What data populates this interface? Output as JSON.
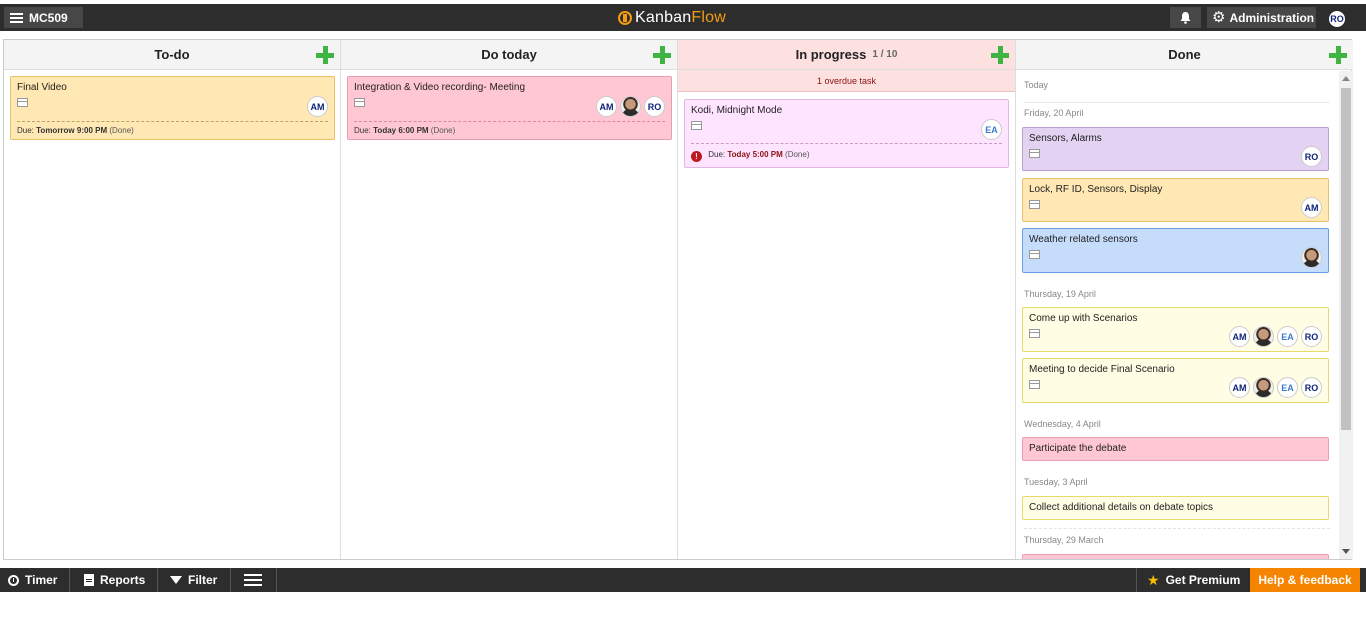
{
  "topbar": {
    "board_name": "MC509",
    "logo_part1": "Kanban",
    "logo_part2": "Flow",
    "admin_label": "Administration",
    "user_initials": "RO"
  },
  "columns": {
    "todo": {
      "title": "To-do"
    },
    "today": {
      "title": "Do today"
    },
    "inprogress": {
      "title": "In progress",
      "wip": "1 / 10",
      "overdue_note": "1 overdue task"
    },
    "done": {
      "title": "Done"
    }
  },
  "tasks": {
    "final_video": {
      "name": "Final Video",
      "avatar": "AM",
      "due_prefix": "Due:",
      "due": "Tomorrow 9:00 PM",
      "status": "(Done)"
    },
    "integration": {
      "name": "Integration & Video recording- Meeting",
      "avatar1": "AM",
      "avatar3": "RO",
      "due_prefix": "Due:",
      "due": "Today 6:00 PM",
      "status": "(Done)"
    },
    "kodi": {
      "name": "Kodi, Midnight Mode",
      "avatar": "EA",
      "due_prefix": "Due:",
      "due": "Today 5:00 PM",
      "status": "(Done)"
    }
  },
  "done": {
    "sep_today": "Today",
    "sep_fri": "Friday, 20 April",
    "sensors_alarms": {
      "name": "Sensors, Alarms",
      "avatar": "RO"
    },
    "lock_rfid": {
      "name": "Lock, RF ID, Sensors, Display",
      "avatar": "AM"
    },
    "weather": {
      "name": "Weather related sensors"
    },
    "sep_thu": "Thursday, 19 April",
    "scenarios": {
      "name": "Come up with Scenarios",
      "a1": "AM",
      "a3": "EA",
      "a4": "RO"
    },
    "meeting_final": {
      "name": "Meeting to decide Final Scenario",
      "a1": "AM",
      "a3": "EA",
      "a4": "RO"
    },
    "sep_wed": "Wednesday, 4 April",
    "debate": {
      "name": "Participate the debate"
    },
    "sep_tue": "Tuesday, 3 April",
    "details": {
      "name": "Collect additional details on debate topics"
    },
    "sep_thu2": "Thursday, 29 March"
  },
  "bottombar": {
    "timer": "Timer",
    "reports": "Reports",
    "filter": "Filter",
    "premium": "Get Premium",
    "help": "Help & feedback"
  },
  "colors": {
    "accent_orange": "#f58400",
    "add_green": "#3fb443",
    "topbar": "#2d2d2d"
  },
  "icons": [
    "menu-icon",
    "bell-icon",
    "gear-icon",
    "plus-icon",
    "calendar-icon",
    "warning-icon",
    "clock-icon",
    "report-icon",
    "filter-icon",
    "star-icon"
  ]
}
